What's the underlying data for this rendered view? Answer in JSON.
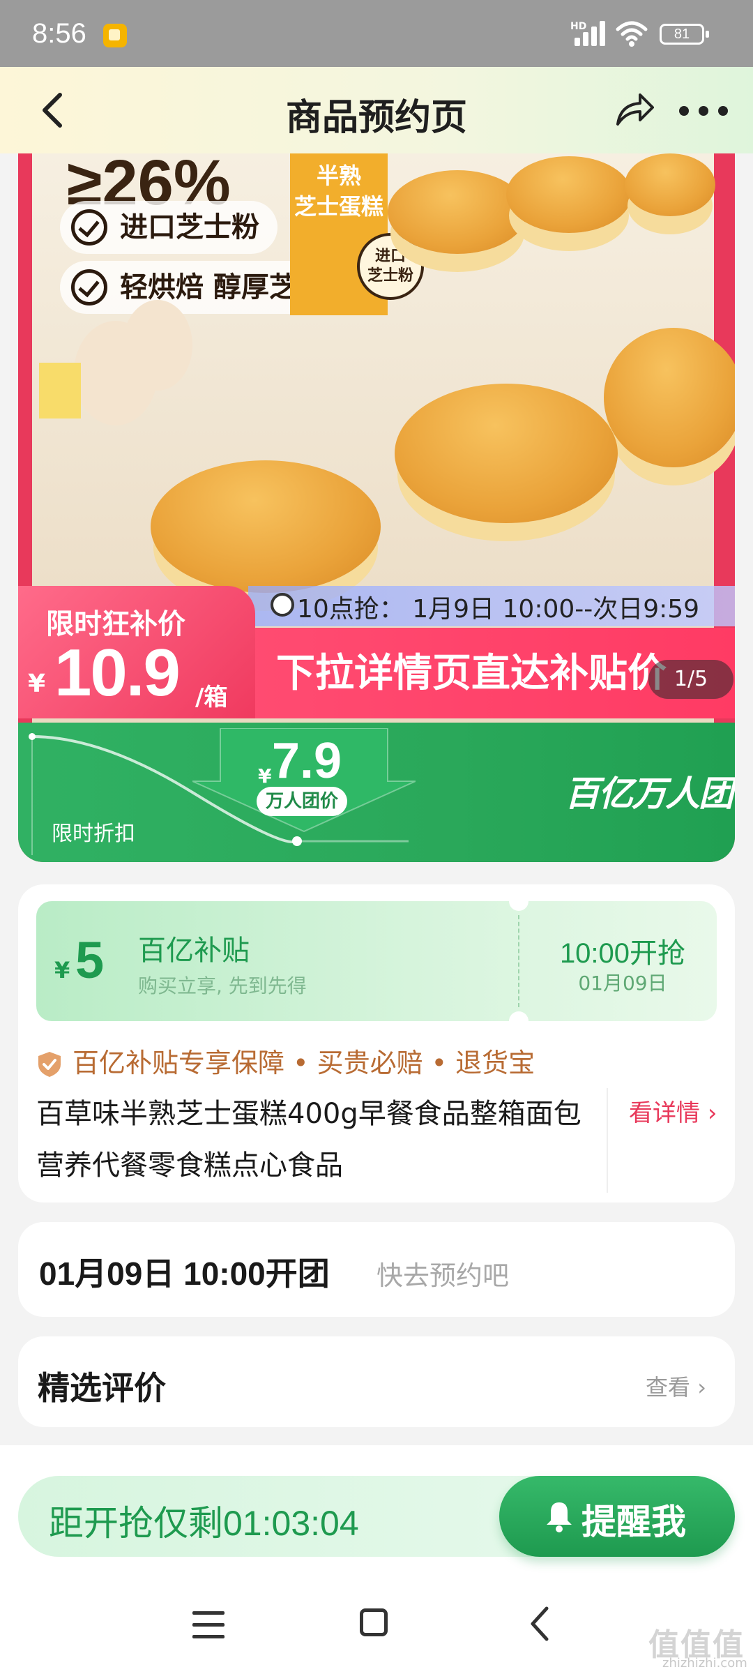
{
  "status_bar": {
    "time": "8:56",
    "network": "HD",
    "battery": "81"
  },
  "header": {
    "title": "商品预约页"
  },
  "hero": {
    "percent_fragment": "≥26%",
    "box_text_line1": "半熟",
    "box_text_line2": "芝士蛋糕",
    "badge_line1": "进口",
    "badge_line2": "芝士粉",
    "tags": [
      "进口芝士粉",
      "轻烘焙 醇厚芝香"
    ],
    "flash_time": "10点抢：  1月9日   10:00--次日9:59",
    "limited_label": "限时狂补价",
    "currency": "¥",
    "price": "10.9",
    "price_unit": "/箱",
    "slogan": "下拉详情页直达补贴价",
    "pager": "1/5",
    "discount_label": "限时折扣",
    "group_price": "7.9",
    "group_tag": "万人团价",
    "brand": "百亿万人团"
  },
  "coupon": {
    "currency": "¥",
    "value": "5",
    "title": "百亿补贴",
    "subtitle": "购买立享, 先到先得",
    "start": "10:00开抢",
    "date": "01月09日"
  },
  "guarantee": "百亿补贴专享保障 • 买贵必赔 • 退货宝",
  "product": {
    "title": "百草味半熟芝士蛋糕400g早餐食品整箱面包营养代餐零食糕点心食品",
    "detail_link": "看详情"
  },
  "open_group": {
    "time": "01月09日 10:00开团",
    "hint": "快去预约吧"
  },
  "reviews": {
    "title": "精选评价",
    "link": "查看"
  },
  "action": {
    "countdown": "距开抢仅剩01:03:04",
    "remind": "提醒我"
  },
  "watermark": {
    "main": "值值值",
    "sub": "zhizhizhi.com"
  },
  "colors": {
    "green": "#1e9a4f",
    "pink": "#e8395b",
    "guarantee": "#b86b33"
  }
}
